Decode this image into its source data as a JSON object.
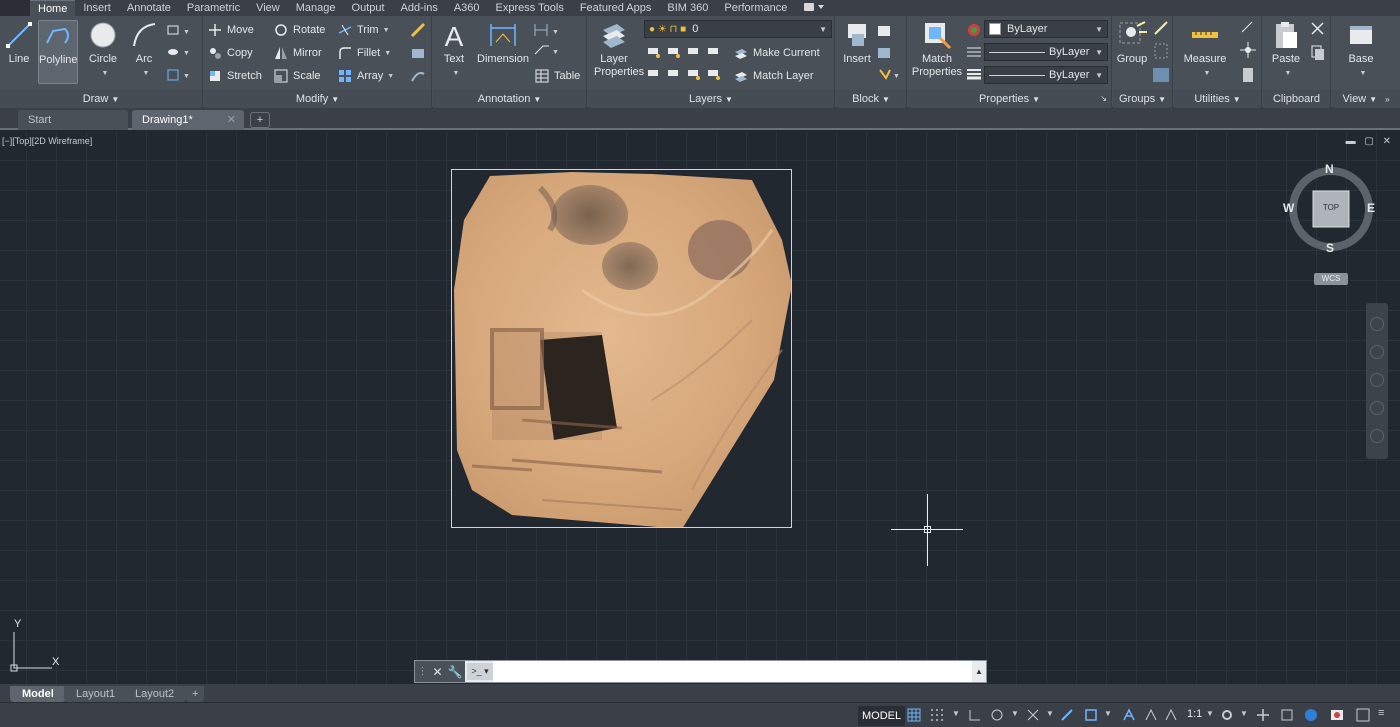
{
  "ribbon_tabs": [
    "Home",
    "Insert",
    "Annotate",
    "Parametric",
    "View",
    "Manage",
    "Output",
    "Add-ins",
    "A360",
    "Express Tools",
    "Featured Apps",
    "BIM 360",
    "Performance"
  ],
  "active_tab": "Home",
  "panels": {
    "draw": {
      "title": "Draw",
      "line": "Line",
      "polyline": "Polyline",
      "circle": "Circle",
      "arc": "Arc"
    },
    "modify": {
      "title": "Modify",
      "move": "Move",
      "rotate": "Rotate",
      "trim": "Trim",
      "copy": "Copy",
      "mirror": "Mirror",
      "fillet": "Fillet",
      "stretch": "Stretch",
      "scale": "Scale",
      "array": "Array"
    },
    "annotation": {
      "title": "Annotation",
      "text": "Text",
      "dimension": "Dimension",
      "table": "Table"
    },
    "layers": {
      "title": "Layers",
      "layer_properties_1": "Layer",
      "layer_properties_2": "Properties",
      "current_layer": "0",
      "make_current": "Make Current",
      "match_layer": "Match Layer"
    },
    "block": {
      "title": "Block",
      "insert": "Insert"
    },
    "properties": {
      "title": "Properties",
      "match_1": "Match",
      "match_2": "Properties",
      "color": "ByLayer",
      "linetype": "ByLayer",
      "lineweight": "ByLayer"
    },
    "groups": {
      "title": "Groups",
      "group": "Group"
    },
    "utilities": {
      "title": "Utilities",
      "measure": "Measure"
    },
    "clipboard": {
      "title": "Clipboard",
      "paste": "Paste"
    },
    "view": {
      "title": "View",
      "base": "Base"
    }
  },
  "doc_tabs": {
    "start": "Start",
    "drawing": "Drawing1*"
  },
  "viewport_label": "[−][Top][2D Wireframe]",
  "viewcube": {
    "n": "N",
    "s": "S",
    "e": "E",
    "w": "W",
    "face": "TOP",
    "wcs": "WCS"
  },
  "ucs": {
    "x": "X",
    "y": "Y"
  },
  "command_line": {
    "value": "",
    "placeholder": ""
  },
  "layout_tabs": {
    "model": "Model",
    "layout1": "Layout1",
    "layout2": "Layout2"
  },
  "status": {
    "model": "MODEL",
    "scale": "1:1"
  },
  "colors": {
    "ribbon": "#4a5058",
    "canvas": "#212830",
    "grid": "#2a323c",
    "image_sand": "#d9a87a"
  },
  "icons": [
    "line-icon",
    "polyline-icon",
    "circle-icon",
    "arc-icon",
    "move-icon",
    "rotate-icon",
    "trim-icon",
    "copy-icon",
    "mirror-icon",
    "fillet-icon",
    "stretch-icon",
    "scale-icon",
    "array-icon",
    "text-icon",
    "dimension-icon",
    "table-icon",
    "layer-properties-icon",
    "insert-icon",
    "match-properties-icon",
    "group-icon",
    "measure-icon",
    "paste-icon",
    "base-icon",
    "close-icon",
    "wrench-icon",
    "grid-icon",
    "snap-icon"
  ]
}
